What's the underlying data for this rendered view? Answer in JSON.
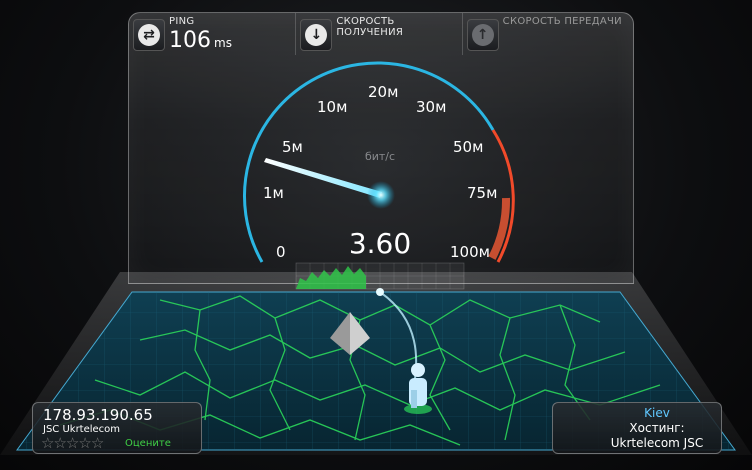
{
  "header": {
    "ping_label": "PING",
    "ping_value": "106",
    "ping_unit": "ms",
    "download_label": "СКОРОСТЬ ПОЛУЧЕНИЯ",
    "upload_label": "СКОРОСТЬ ПЕРЕДАЧИ"
  },
  "gauge": {
    "unit": "бит/с",
    "value": "3.60",
    "needle_value_mbps": 3.6,
    "ticks": [
      "0",
      "1м",
      "5м",
      "10м",
      "20м",
      "30м",
      "50м",
      "75м",
      "100м"
    ]
  },
  "client": {
    "ip": "178.93.190.65",
    "isp": "JSC Ukrtelecom",
    "rating_stars": 5,
    "rate_label": "Оцените"
  },
  "server": {
    "city": "Kiev",
    "host_label": "Хостинг:",
    "host_name": "Ukrtelecom JSC"
  },
  "colors": {
    "gauge_blue": "#2bb6e3",
    "gauge_red": "#f14a2a",
    "accent_green": "#3fcf45",
    "city_blue": "#61c8ff"
  },
  "icons": {
    "ping": "ping-arrows-icon",
    "download": "download-arrow-icon",
    "upload": "upload-arrow-icon"
  }
}
